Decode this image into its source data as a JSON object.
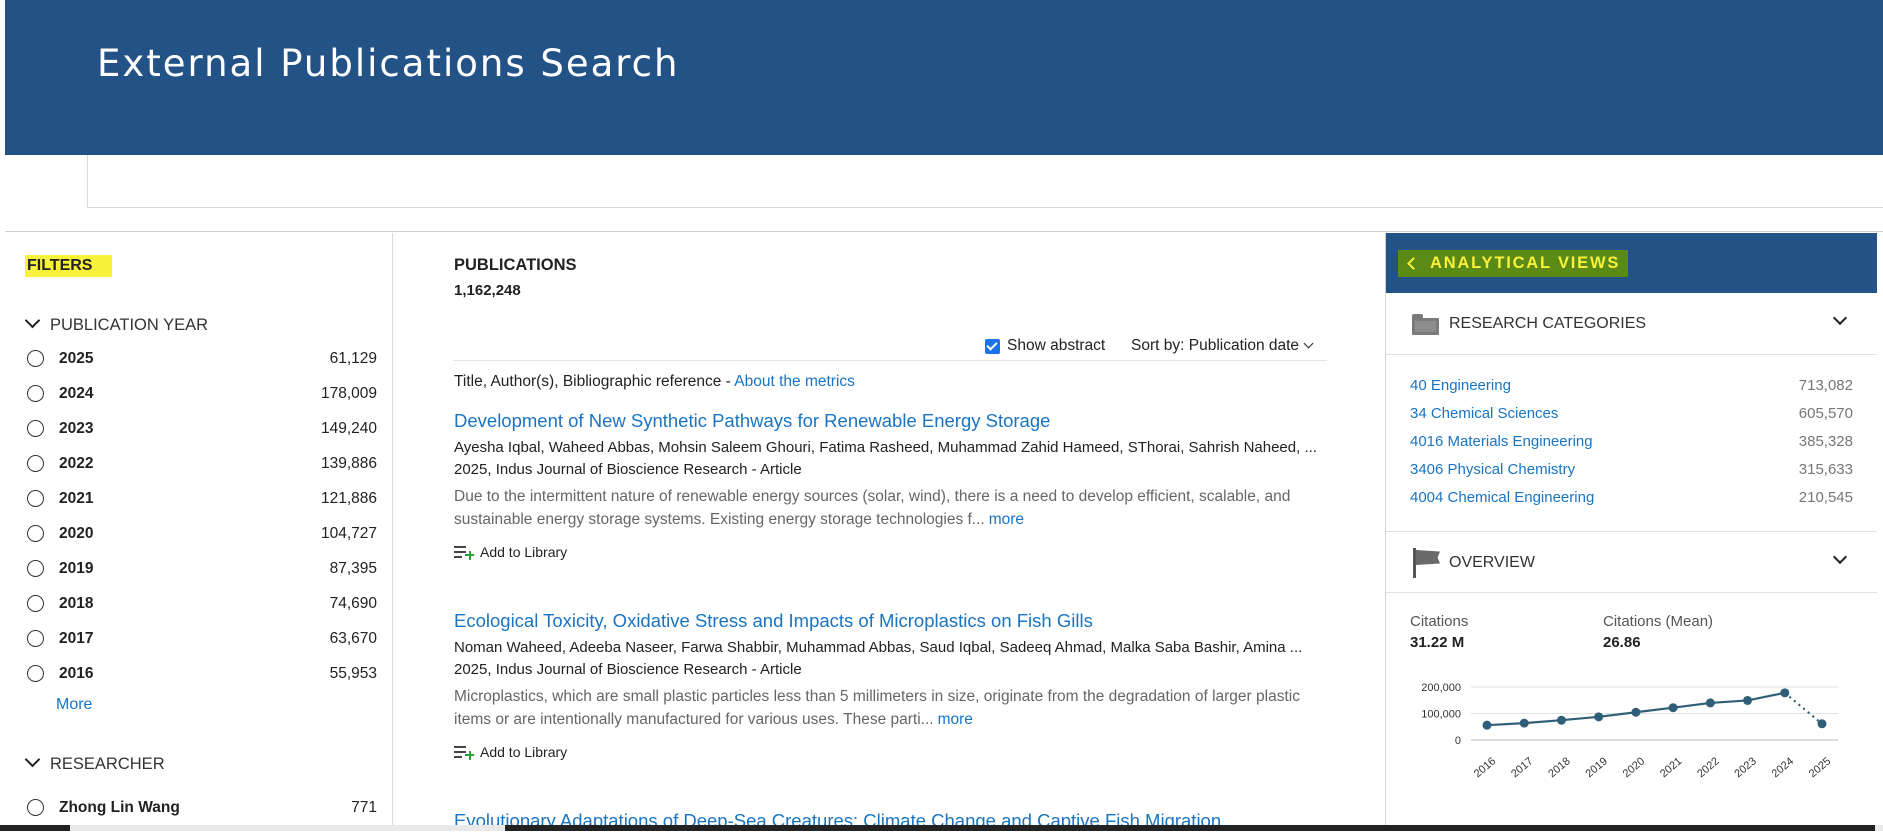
{
  "header": {
    "title": "External Publications Search"
  },
  "search": {
    "placeholder": ""
  },
  "filters": {
    "title": "FILTERS",
    "year_group": "PUBLICATION YEAR",
    "years": [
      {
        "label": "2025",
        "count": "61,129"
      },
      {
        "label": "2024",
        "count": "178,009"
      },
      {
        "label": "2023",
        "count": "149,240"
      },
      {
        "label": "2022",
        "count": "139,886"
      },
      {
        "label": "2021",
        "count": "121,886"
      },
      {
        "label": "2020",
        "count": "104,727"
      },
      {
        "label": "2019",
        "count": "87,395"
      },
      {
        "label": "2018",
        "count": "74,690"
      },
      {
        "label": "2017",
        "count": "63,670"
      },
      {
        "label": "2016",
        "count": "55,953"
      }
    ],
    "more_label": "More",
    "researcher_group": "RESEARCHER",
    "researchers": [
      {
        "label": "Zhong Lin Wang",
        "count": "771"
      }
    ]
  },
  "publications": {
    "title": "PUBLICATIONS",
    "count": "1,162,248",
    "show_abstract_label": "Show abstract",
    "sort_label": "Sort by:",
    "sort_value": "Publication date",
    "column_header": "Title, Author(s), Bibliographic reference - ",
    "metrics_link": "About the metrics",
    "add_to_library": "Add to Library",
    "more_link": "more",
    "items": [
      {
        "title": "Development of New Synthetic Pathways for Renewable Energy Storage",
        "authors": "Ayesha Iqbal, Waheed Abbas, Mohsin Saleem Ghouri, Fatima Rasheed, Muhammad Zahid Hameed, SThorai, Sahrish Naheed, ...",
        "reference": "2025, Indus Journal of Bioscience Research - Article",
        "abstract": "Due to the intermittent nature of renewable energy sources (solar, wind), there is a need to develop efficient, scalable, and sustainable energy storage systems. Existing energy storage technologies f..."
      },
      {
        "title": "Ecological Toxicity, Oxidative Stress and Impacts of Microplastics on Fish Gills",
        "authors": "Noman Waheed, Adeeba Naseer, Farwa Shabbir, Muhammad Abbas, Saud Iqbal, Sadeeq Ahmad, Malka Saba Bashir, Amina ...",
        "reference": "2025, Indus Journal of Bioscience Research - Article",
        "abstract": "Microplastics, which are small plastic particles less than 5 millimeters in size, originate from the degradation of larger plastic items or are intentionally manufactured for various uses. These parti..."
      },
      {
        "title": "Evolutionary Adaptations of Deep-Sea Creatures: Climate Change and Captive Fish Migration"
      }
    ]
  },
  "panel": {
    "title": "ANALYTICAL VIEWS",
    "categories_title": "RESEARCH CATEGORIES",
    "categories": [
      {
        "name": "40 Engineering",
        "value": "713,082"
      },
      {
        "name": "34 Chemical Sciences",
        "value": "605,570"
      },
      {
        "name": "4016 Materials Engineering",
        "value": "385,328"
      },
      {
        "name": "3406 Physical Chemistry",
        "value": "315,633"
      },
      {
        "name": "4004 Chemical Engineering",
        "value": "210,545"
      }
    ],
    "overview_title": "OVERVIEW",
    "citations_label": "Citations",
    "citations_value": "31.22 M",
    "citations_mean_label": "Citations (Mean)",
    "citations_mean_value": "26.86"
  },
  "chart_data": {
    "type": "line",
    "x": [
      "2016",
      "2017",
      "2018",
      "2019",
      "2020",
      "2021",
      "2022",
      "2023",
      "2024",
      "2025"
    ],
    "series": [
      {
        "values": [
          55953,
          63670,
          74690,
          87395,
          104727,
          121886,
          139886,
          149240,
          178009,
          61129
        ]
      }
    ],
    "y_ticks": [
      "0",
      "100,000",
      "200,000"
    ],
    "ylim": [
      0,
      200000
    ],
    "last_segment_dotted": true,
    "grid": true,
    "colors": {
      "line": "#2f5f78"
    }
  }
}
